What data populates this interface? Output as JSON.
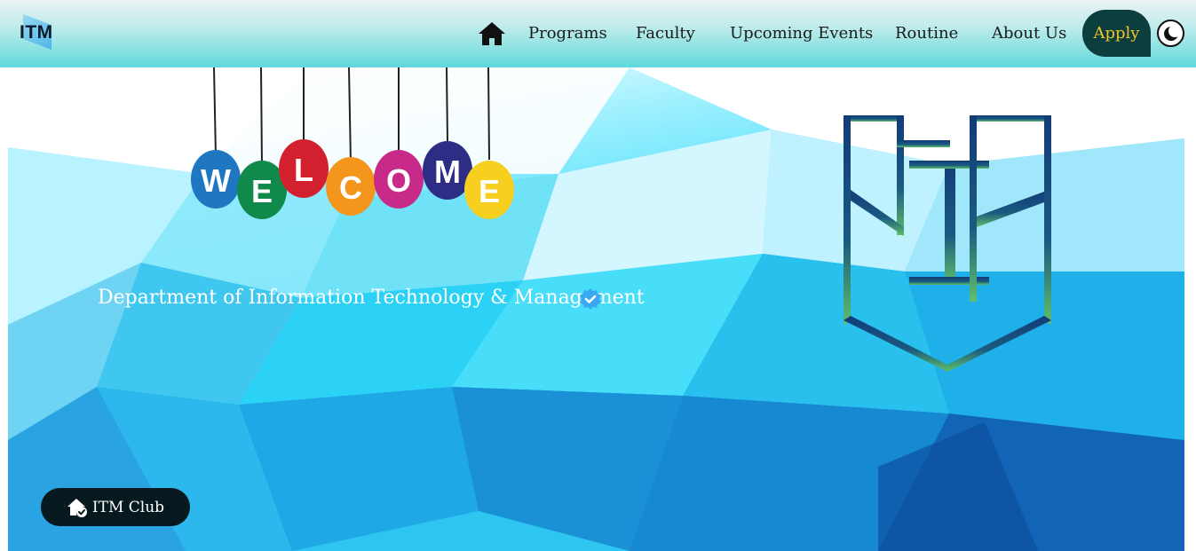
{
  "brand": {
    "logo_text": "ITM",
    "logo_icon": "itm-logo-icon"
  },
  "nav": {
    "home_icon": "home-icon",
    "links": [
      "Programs",
      "Faculty",
      "Upcoming Events",
      "Routine",
      "About Us"
    ],
    "apply_label": "Apply",
    "theme_toggle_icon": "moon-icon"
  },
  "hero": {
    "welcome_letters": [
      "W",
      "E",
      "L",
      "C",
      "O",
      "M",
      "E"
    ],
    "welcome_colors": [
      "#1f77c2",
      "#0f8a4a",
      "#d3202e",
      "#f4951c",
      "#c82a8a",
      "#2e2d86",
      "#f7cf1f"
    ],
    "department": "Department of Information Technology & Management",
    "verified_icon": "verified-badge-icon",
    "emblem": "itm-emblem"
  },
  "club_button": {
    "label": "ITM Club",
    "icon": "home-check-icon"
  },
  "colors": {
    "nav_text": "#1a1a1a",
    "apply_bg": "#0c3e3e",
    "apply_text": "#f2c230",
    "club_bg": "#06191e",
    "emblem_blue": "#123c78",
    "emblem_green": "#5fbf6b"
  }
}
